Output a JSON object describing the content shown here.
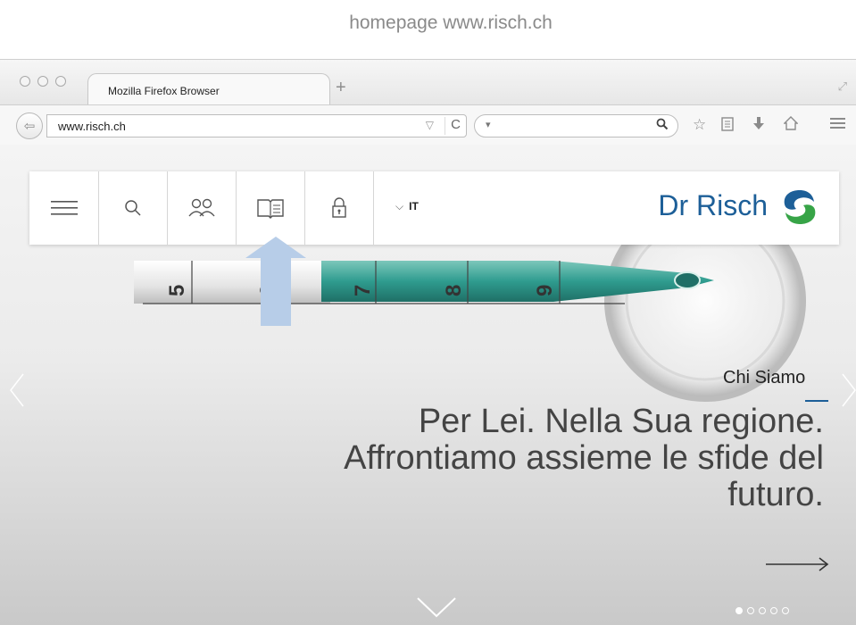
{
  "caption": "homepage www.risch.ch",
  "browser": {
    "tab_title": "Mozilla Firefox Browser",
    "new_tab_glyph": "+",
    "url": "www.risch.ch",
    "url_dropdown_glyph": "▽",
    "reload_glyph": "C",
    "search_engine_glyph": "▾"
  },
  "site": {
    "language": "IT",
    "brand_name": "Dr Risch",
    "slide_label": "Chi Siamo",
    "headline_line1": "Per Lei. Nella Sua regione.",
    "headline_line2": "Affrontiamo assieme le sfide del",
    "headline_line3": "futuro.",
    "slides_total": 5,
    "active_slide": 1
  },
  "icons": [
    "back-arrow-icon",
    "reload-icon",
    "search-icon",
    "star-icon",
    "clipboard-icon",
    "download-icon",
    "home-icon",
    "menu-icon",
    "hamburger-menu-icon",
    "people-icon",
    "book-icon",
    "lock-icon",
    "chevron-down-icon",
    "dr-risch-logo",
    "pipette-illustration",
    "annotation-arrow"
  ],
  "colors": {
    "brand_blue": "#1d5f98",
    "logo_green": "#37a447",
    "annotation_arrow": "#b7cde8",
    "liquid_teal": "#2f9c8f"
  }
}
